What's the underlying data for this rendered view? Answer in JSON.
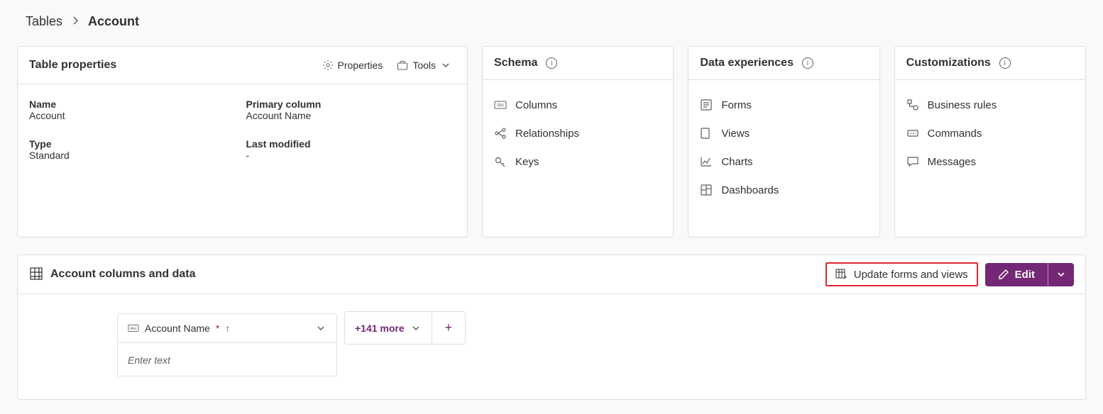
{
  "breadcrumb": {
    "root": "Tables",
    "current": "Account"
  },
  "tableProps": {
    "title": "Table properties",
    "propertiesLabel": "Properties",
    "toolsLabel": "Tools",
    "nameLabel": "Name",
    "nameValue": "Account",
    "primaryLabel": "Primary column",
    "primaryValue": "Account Name",
    "typeLabel": "Type",
    "typeValue": "Standard",
    "modifiedLabel": "Last modified",
    "modifiedValue": "-"
  },
  "schema": {
    "title": "Schema",
    "columns": "Columns",
    "relationships": "Relationships",
    "keys": "Keys"
  },
  "dataExp": {
    "title": "Data experiences",
    "forms": "Forms",
    "views": "Views",
    "charts": "Charts",
    "dashboards": "Dashboards"
  },
  "custom": {
    "title": "Customizations",
    "rules": "Business rules",
    "commands": "Commands",
    "messages": "Messages"
  },
  "dataSection": {
    "title": "Account columns and data",
    "updateLabel": "Update forms and views",
    "editLabel": "Edit",
    "colName": "Account Name",
    "moreLabel": "+141 more",
    "placeholder": "Enter text"
  }
}
